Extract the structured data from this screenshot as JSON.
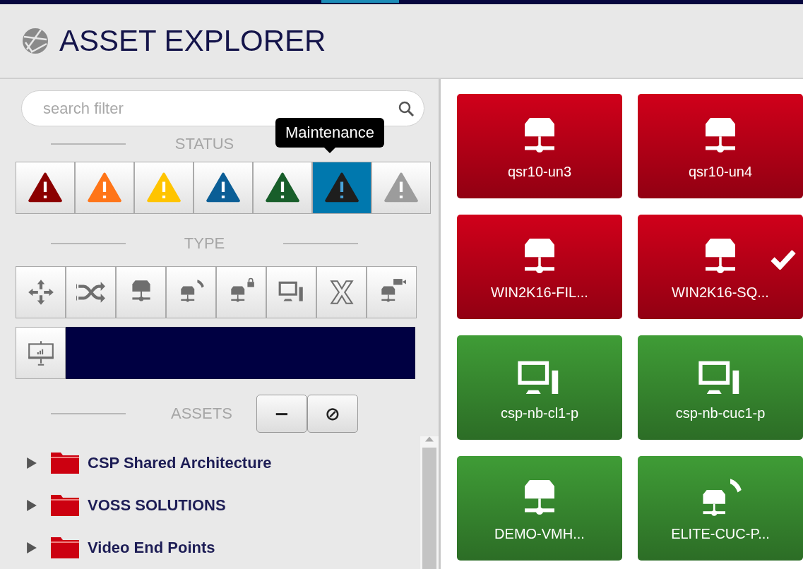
{
  "window": {
    "title": "ASSET EXPLORER"
  },
  "search": {
    "placeholder": "search filter"
  },
  "status_section": {
    "label": "STATUS",
    "tooltip": "Maintenance"
  },
  "statuses": [
    {
      "color": "#8b0000",
      "selected": false
    },
    {
      "color": "#ff7518",
      "selected": false
    },
    {
      "color": "#ffc400",
      "selected": false
    },
    {
      "color": "#0b5e96",
      "selected": false
    },
    {
      "color": "#185e2a",
      "selected": false
    },
    {
      "color": "#1e1e1e",
      "selected": true
    },
    {
      "color": "#9c9c9c",
      "selected": false
    }
  ],
  "type_section": {
    "label": "TYPE"
  },
  "types": [
    {
      "kind": "move",
      "selected": false
    },
    {
      "kind": "shuffle",
      "selected": false
    },
    {
      "kind": "server",
      "selected": false
    },
    {
      "kind": "server-phone",
      "selected": false
    },
    {
      "kind": "server-lock",
      "selected": false
    },
    {
      "kind": "desktop",
      "selected": false
    },
    {
      "kind": "x",
      "selected": false
    },
    {
      "kind": "server-camera",
      "selected": false
    },
    {
      "kind": "presentation",
      "selected": false
    }
  ],
  "assets_section": {
    "label": "ASSETS",
    "buttons": [
      "−",
      "⊘"
    ]
  },
  "tree": [
    {
      "label": "CSP Shared Architecture",
      "expanded": false
    },
    {
      "label": "VOSS SOLUTIONS",
      "expanded": false
    },
    {
      "label": "Video End Points",
      "expanded": false
    }
  ],
  "tiles": [
    {
      "label": "qsr10-un3",
      "color": "#d0001a",
      "kind": "server",
      "checked": false
    },
    {
      "label": "qsr10-un4",
      "color": "#d0001a",
      "kind": "server",
      "checked": false
    },
    {
      "label": "WIN2K16-FIL...",
      "color": "#d0001a",
      "kind": "server",
      "checked": false
    },
    {
      "label": "WIN2K16-SQ...",
      "color": "#d0001a",
      "kind": "server",
      "checked": true
    },
    {
      "label": "csp-nb-cl1-p",
      "color": "#3f9c36",
      "kind": "desktop",
      "checked": false
    },
    {
      "label": "csp-nb-cuc1-p",
      "color": "#3f9c36",
      "kind": "desktop",
      "checked": false
    },
    {
      "label": "DEMO-VMH...",
      "color": "#3f9c36",
      "kind": "server",
      "checked": false
    },
    {
      "label": "ELITE-CUC-P...",
      "color": "#3f9c36",
      "kind": "server-phone",
      "checked": false
    }
  ]
}
